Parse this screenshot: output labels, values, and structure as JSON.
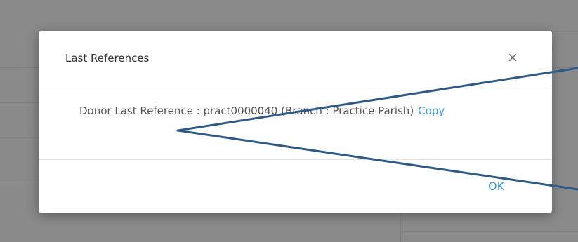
{
  "dialog": {
    "title": "Last References",
    "close_glyph": "×",
    "body": {
      "message": "Donor Last Reference : pract0000040 (Branch : Practice Parish)",
      "copy_label": "Copy"
    },
    "footer": {
      "ok_label": "OK"
    }
  },
  "colors": {
    "overlay": "#8a8a8a",
    "link": "#3b9ad9",
    "annotation_line": "#2e5a87"
  },
  "icons": {
    "close": "close-icon"
  }
}
